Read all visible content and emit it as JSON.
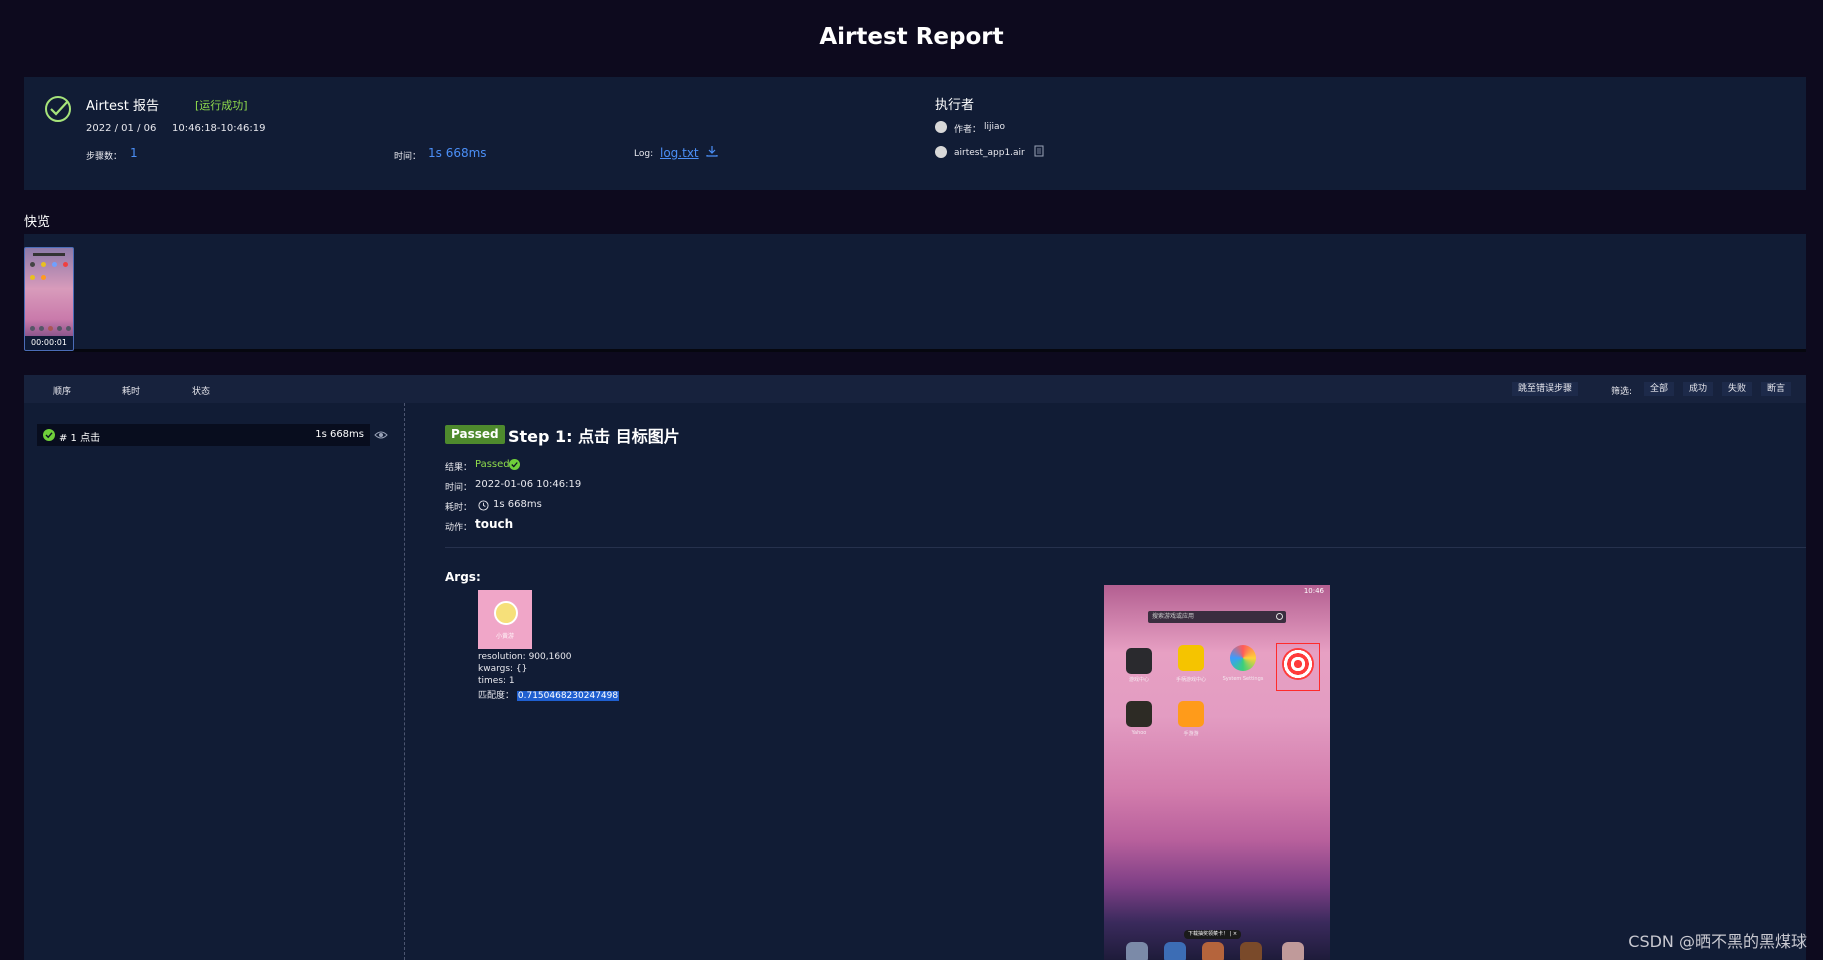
{
  "header": {
    "title": "Airtest Report"
  },
  "info": {
    "report_name": "Airtest 报告",
    "run_status": "[运行成功]",
    "date": "2022 / 01 / 06",
    "time_range": "10:46:18-10:46:19",
    "steps_label": "步骤数：",
    "steps_value": "1",
    "time_label": "时间：",
    "time_value": "1s 668ms",
    "log_label": "Log:",
    "log_link": "log.txt",
    "executor_title": "执行者",
    "author_label": "作者：",
    "author_value": "lijiao",
    "script_name": "airtest_app1.air"
  },
  "preview": {
    "title": "快览",
    "thumb_time": "00:00:01"
  },
  "step_header": {
    "col_order": "顺序",
    "col_duration": "耗时",
    "col_status": "状态",
    "jump_error": "跳至错误步骤",
    "filter_label": "筛选:",
    "filter_all": "全部",
    "filter_success": "成功",
    "filter_fail": "失败",
    "filter_assert": "断言"
  },
  "step_list": [
    {
      "label": "# 1 点击",
      "duration": "1s 668ms",
      "status": "passed"
    }
  ],
  "detail": {
    "badge": "Passed",
    "title": "Step 1: 点击 目标图片",
    "result_label": "结果：",
    "result_value": "Passed",
    "time_label": "时间：",
    "time_value": "2022-01-06 10:46:19",
    "duration_label": "耗时：",
    "duration_value": "1s 668ms",
    "action_label": "动作：",
    "action_value": "touch",
    "args_title": "Args:",
    "target_caption": "小黄游",
    "resolution": "resolution: 900,1600",
    "kwargs": "kwargs: {}",
    "times": "times: 1",
    "confidence_label": "匹配度：",
    "confidence_value": "0.7150468230247498"
  },
  "phone": {
    "status_time": "10:46",
    "search_placeholder": "搜索游戏或应用",
    "apps": [
      "游戏中心",
      "手柄游戏中心",
      "System Settings",
      "Yahoo",
      "手游游"
    ],
    "toast": "下载抽奖领菜卡！ | ×"
  },
  "watermark": "CSDN @晒不黑的黑煤球",
  "colors": {
    "background": "#0d0a1e",
    "panel": "#111c35",
    "accent_blue": "#4b8ff7",
    "success_green": "#8fdc4c",
    "badge_green": "#4e8a2d",
    "match_red": "#ff2b2b"
  }
}
